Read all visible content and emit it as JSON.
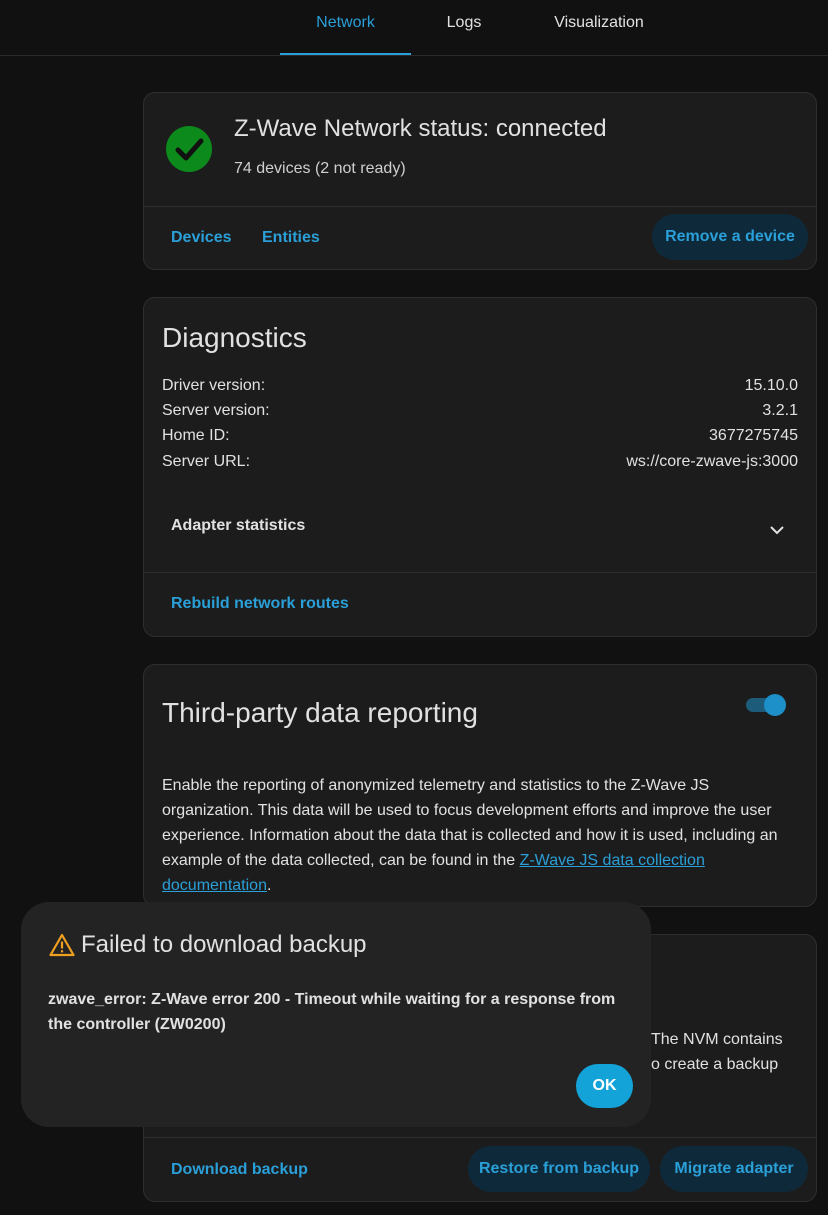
{
  "tabs": [
    {
      "label": "Network",
      "active": true
    },
    {
      "label": "Logs",
      "active": false
    },
    {
      "label": "Visualization",
      "active": false
    }
  ],
  "status_card": {
    "title": "Z-Wave Network status: connected",
    "subtitle": "74 devices (2 not ready)",
    "status_icon": "check-circle-icon",
    "status_color": "#0c8a1c",
    "devices_label": "Devices",
    "entities_label": "Entities",
    "remove_label": "Remove a device"
  },
  "diagnostics": {
    "title": "Diagnostics",
    "rows": [
      {
        "key": "Driver version:",
        "value": "15.10.0"
      },
      {
        "key": "Server version:",
        "value": "3.2.1"
      },
      {
        "key": "Home ID:",
        "value": "3677275745"
      },
      {
        "key": "Server URL:",
        "value": "ws://core-zwave-js:3000"
      }
    ],
    "adapter_stats_label": "Adapter statistics",
    "rebuild_label": "Rebuild network routes"
  },
  "third_party": {
    "title": "Third-party data reporting",
    "toggle_on": true,
    "text_before_link": "Enable the reporting of anonymized telemetry and statistics to the Z-Wave JS organization. This data will be used to focus development efforts and improve the user experience. Information about the data that is collected and how it is used, including an example of the data collected, can be found in the ",
    "link_text": "Z-Wave JS data collection documentation",
    "text_after_link": "."
  },
  "backup_card": {
    "fragment_1": "The NVM contains",
    "fragment_2": "o create a backup",
    "download_label": "Download backup",
    "restore_label": "Restore from backup",
    "migrate_label": "Migrate adapter"
  },
  "dialog": {
    "title": "Failed to download backup",
    "message": "zwave_error: Z-Wave error 200 - Timeout while waiting for a response from the controller (ZW0200)",
    "ok_label": "OK",
    "warning_icon": "warning-icon",
    "warning_color": "#f0a020"
  },
  "colors": {
    "accent": "#2a9fd8",
    "background": "#111111",
    "card": "#1c1c1c"
  }
}
